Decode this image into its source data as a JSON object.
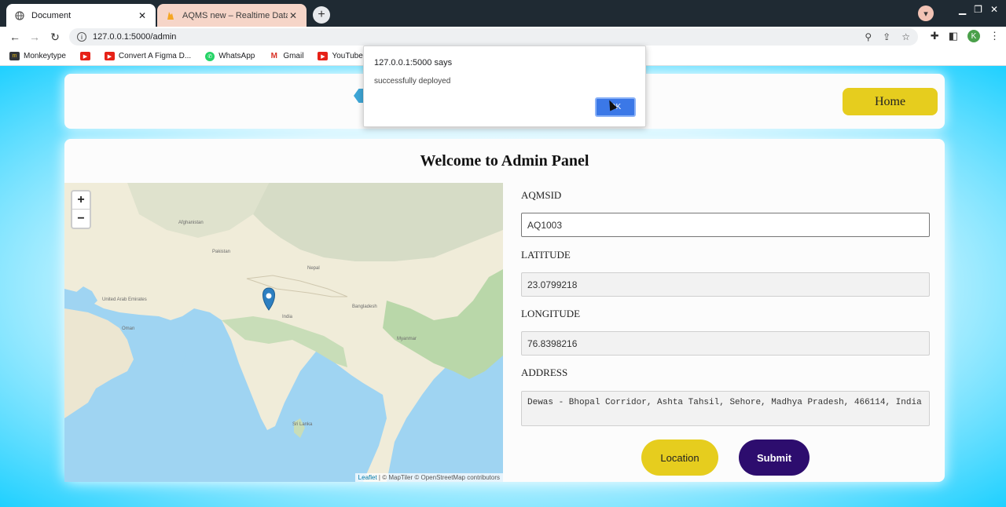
{
  "browser": {
    "tabs": [
      {
        "title": "Document",
        "active": true
      },
      {
        "title": "AQMS new – Realtime Database",
        "active": false
      }
    ],
    "url": "127.0.0.1:5000/admin",
    "profile_initial": "K",
    "bookmarks": [
      {
        "label": "Monkeytype",
        "icon": "monkeytype-icon"
      },
      {
        "label": "",
        "icon": "youtube-icon"
      },
      {
        "label": "Convert A Figma D...",
        "icon": "youtube-icon"
      },
      {
        "label": "WhatsApp",
        "icon": "whatsapp-icon"
      },
      {
        "label": "Gmail",
        "icon": "gmail-icon"
      },
      {
        "label": "YouTube",
        "icon": "youtube-icon"
      },
      {
        "label": "",
        "icon": "maps-icon"
      }
    ]
  },
  "header": {
    "home_label": "Home"
  },
  "main": {
    "title": "Welcome to Admin Panel",
    "map": {
      "zoom_in": "+",
      "zoom_out": "−",
      "attribution_leaflet": "Leaflet",
      "attribution_rest": " | © MapTiler © OpenStreetMap contributors",
      "place_labels": [
        "Afghanistan",
        "Pakistan",
        "Nepal",
        "India",
        "Bangladesh",
        "Oman",
        "United Arab Emirates",
        "Myanmar",
        "Sri Lanka"
      ]
    },
    "form": {
      "aqmsid_label": "AQMSID",
      "aqmsid_value": "AQ1003",
      "latitude_label": "LATITUDE",
      "latitude_value": "23.0799218",
      "longitude_label": "LONGITUDE",
      "longitude_value": "76.8398216",
      "address_label": "ADDRESS",
      "address_value": "Dewas - Bhopal Corridor, Ashta Tahsil, Sehore, Madhya Pradesh, 466114, India"
    },
    "location_label": "Location",
    "submit_label": "Submit"
  },
  "dialog": {
    "title": "127.0.0.1:5000 says",
    "message": "successfully deployed",
    "ok_label": "OK"
  },
  "colors": {
    "page_background": "#1fd0ff",
    "home_button": "#e6cd1e",
    "location_button": "#e6cd1e",
    "submit_button": "#2d0d6e",
    "dialog_ok": "#3b78e7"
  }
}
